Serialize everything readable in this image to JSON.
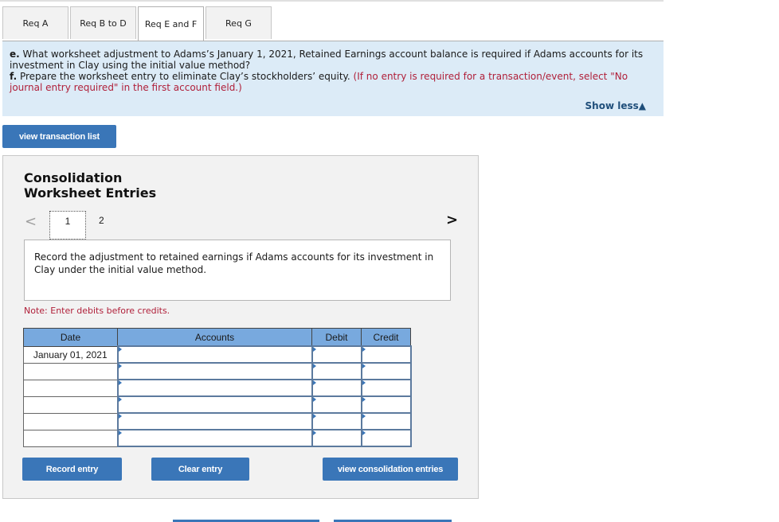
{
  "tabs": [
    {
      "label": "Req A",
      "active": false
    },
    {
      "label": "Req B to D",
      "active": false
    },
    {
      "label": "Req E and F",
      "active": true
    },
    {
      "label": "Req G",
      "active": false
    }
  ],
  "question": {
    "e_label": "e.",
    "e_text": " What worksheet adjustment to Adams’s January 1, 2021, Retained Earnings account balance is required if Adams accounts for its investment in Clay using the initial value method?",
    "f_label": "f.",
    "f_text": " Prepare the worksheet entry to eliminate Clay’s stockholders’ equity. ",
    "f_note": "(If no entry is required for a transaction/event, select \"No journal entry required\" in the first account field.)",
    "show_less": "Show less",
    "show_less_icon": "▲"
  },
  "view_transaction_list": "view transaction list",
  "panel": {
    "title_line1": "Consolidation",
    "title_line2": "Worksheet Entries",
    "pager": {
      "prev_icon": "<",
      "pages": [
        "1",
        "2"
      ],
      "current": "1",
      "next_icon": ">"
    },
    "instruction": "Record the adjustment to retained earnings if Adams accounts for its investment in Clay under the initial value method.",
    "note": "Note: Enter debits before credits.",
    "table": {
      "headers": [
        "Date",
        "Accounts",
        "Debit",
        "Credit"
      ],
      "rows": [
        {
          "date": "January 01, 2021",
          "account": "",
          "debit": "",
          "credit": ""
        },
        {
          "date": "",
          "account": "",
          "debit": "",
          "credit": ""
        },
        {
          "date": "",
          "account": "",
          "debit": "",
          "credit": ""
        },
        {
          "date": "",
          "account": "",
          "debit": "",
          "credit": ""
        },
        {
          "date": "",
          "account": "",
          "debit": "",
          "credit": ""
        },
        {
          "date": "",
          "account": "",
          "debit": "",
          "credit": ""
        }
      ]
    },
    "buttons": {
      "record": "Record entry",
      "clear": "Clear entry",
      "view_consolidation": "view consolidation entries"
    }
  }
}
